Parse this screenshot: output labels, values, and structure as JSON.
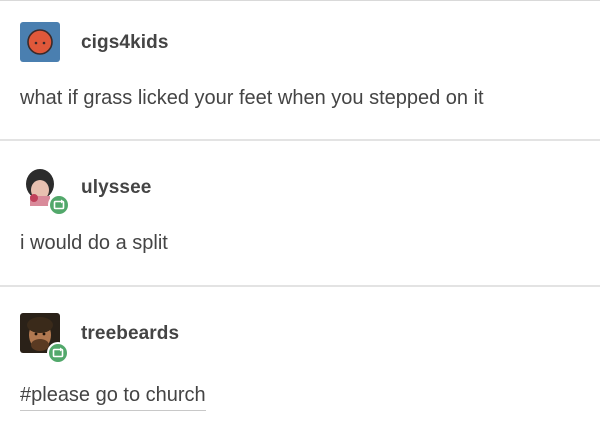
{
  "posts": [
    {
      "username": "cigs4kids",
      "text": "what if grass licked your feet when you stepped on it",
      "avatar_icon": "orange-face-avatar",
      "avatar_colors": {
        "background": "#4a7fb0",
        "circle": "#e0583a"
      }
    },
    {
      "username": "ulyssee",
      "text": "i would do a split",
      "avatar_icon": "photo-avatar",
      "badge_icon": "reblog-icon",
      "badge_color": "#52a86b"
    },
    {
      "username": "treebeards",
      "text": "#please go to church",
      "avatar_icon": "photo-avatar",
      "badge_icon": "reblog-icon",
      "badge_color": "#52a86b"
    }
  ]
}
